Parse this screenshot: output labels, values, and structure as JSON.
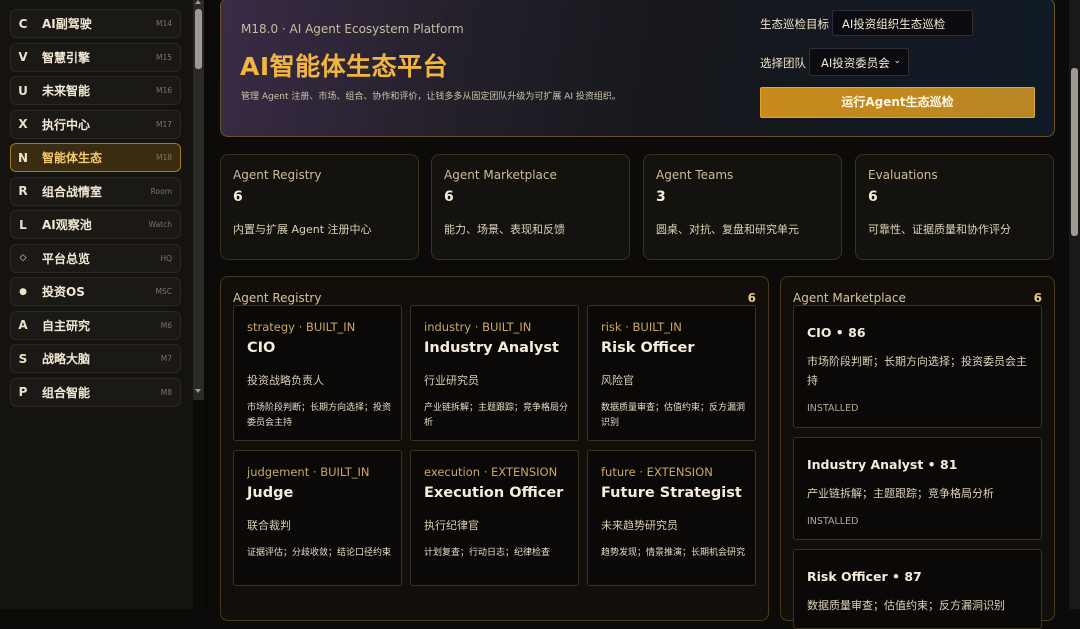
{
  "sidebar": {
    "items": [
      {
        "key": "C",
        "label": "AI副驾驶",
        "code": "M14",
        "active": false
      },
      {
        "key": "V",
        "label": "智慧引擎",
        "code": "M15",
        "active": false
      },
      {
        "key": "U",
        "label": "未来智能",
        "code": "M16",
        "active": false
      },
      {
        "key": "X",
        "label": "执行中心",
        "code": "M17",
        "active": false
      },
      {
        "key": "N",
        "label": "智能体生态",
        "code": "M18",
        "active": true
      },
      {
        "key": "R",
        "label": "组合战情室",
        "code": "Room",
        "active": false
      },
      {
        "key": "L",
        "label": "AI观察池",
        "code": "Watch",
        "active": false
      },
      {
        "key": "◇",
        "label": "平台总览",
        "code": "HQ",
        "active": false
      },
      {
        "key": "●",
        "label": "投资OS",
        "code": "MSC",
        "active": false
      },
      {
        "key": "A",
        "label": "自主研究",
        "code": "M6",
        "active": false
      },
      {
        "key": "S",
        "label": "战略大脑",
        "code": "M7",
        "active": false
      },
      {
        "key": "P",
        "label": "组合智能",
        "code": "M8",
        "active": false
      }
    ]
  },
  "hero": {
    "subtitle": "M18.0 · AI Agent Ecosystem Platform",
    "title": "AI智能体生态平台",
    "description": "管理 Agent 注册、市场、组合、协作和评价，让钱多多从固定团队升级为可扩展 AI 投资组织。",
    "target_label": "生态巡检目标",
    "target_value": "AI投资组织生态巡检",
    "team_label": "选择团队",
    "team_value": "AI投资委员会",
    "run_button": "运行Agent生态巡检"
  },
  "stats": [
    {
      "title": "Agent Registry",
      "value": "6",
      "desc": "内置与扩展 Agent 注册中心"
    },
    {
      "title": "Agent Marketplace",
      "value": "6",
      "desc": "能力、场景、表现和反馈"
    },
    {
      "title": "Agent Teams",
      "value": "3",
      "desc": "圆桌、对抗、复盘和研究单元"
    },
    {
      "title": "Evaluations",
      "value": "6",
      "desc": "可靠性、证据质量和协作评分"
    }
  ],
  "registry": {
    "title": "Agent Registry",
    "count": "6",
    "agents": [
      {
        "tag": "strategy · BUILT_IN",
        "name": "CIO",
        "role": "投资战略负责人",
        "caps": "市场阶段判断；长期方向选择；投资委员会主持"
      },
      {
        "tag": "industry · BUILT_IN",
        "name": "Industry Analyst",
        "role": "行业研究员",
        "caps": "产业链拆解；主题跟踪；竞争格局分析"
      },
      {
        "tag": "risk · BUILT_IN",
        "name": "Risk Officer",
        "role": "风险官",
        "caps": "数据质量审查；估值约束；反方漏洞识别"
      },
      {
        "tag": "judgement · BUILT_IN",
        "name": "Judge",
        "role": "联合裁判",
        "caps": "证据评估；分歧收敛；结论口径约束"
      },
      {
        "tag": "execution · EXTENSION",
        "name": "Execution Officer",
        "role": "执行纪律官",
        "caps": "计划复查；行动日志；纪律检查"
      },
      {
        "tag": "future · EXTENSION",
        "name": "Future Strategist",
        "role": "未来趋势研究员",
        "caps": "趋势发现；情景推演；长期机会研究"
      }
    ]
  },
  "marketplace": {
    "title": "Agent Marketplace",
    "count": "6",
    "items": [
      {
        "name": "CIO • 86",
        "desc": "市场阶段判断；长期方向选择；投资委员会主持",
        "status": "INSTALLED"
      },
      {
        "name": "Industry Analyst • 81",
        "desc": "产业链拆解；主题跟踪；竞争格局分析",
        "status": "INSTALLED"
      },
      {
        "name": "Risk Officer • 87",
        "desc": "数据质量审查；估值约束；反方漏洞识别",
        "status": ""
      }
    ]
  }
}
